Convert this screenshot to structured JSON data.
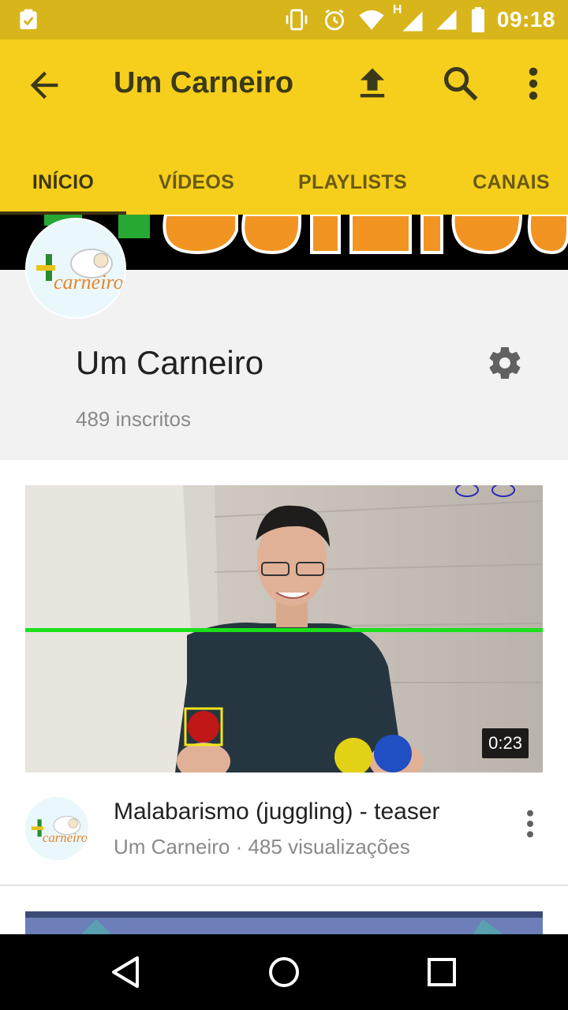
{
  "status_bar": {
    "time": "09:18",
    "network_label": "H",
    "icons": [
      "clipboard-check-icon",
      "vibrate-icon",
      "alarm-icon",
      "wifi-icon",
      "signal-icon",
      "signal-icon-2",
      "battery-icon"
    ]
  },
  "app_bar": {
    "title": "Um Carneiro",
    "icons": [
      "back-arrow-icon",
      "upload-icon",
      "search-icon",
      "more-vert-icon"
    ],
    "tabs": [
      {
        "label": "INÍCIO",
        "active": true
      },
      {
        "label": "VÍDEOS",
        "active": false
      },
      {
        "label": "PLAYLISTS",
        "active": false
      },
      {
        "label": "CANAIS",
        "active": false
      }
    ]
  },
  "channel": {
    "name": "Um Carneiro",
    "subscribers": "489 inscritos",
    "logo_text": "carneiro",
    "settings_icon": "gear-icon"
  },
  "video": {
    "title": "Malabarismo (juggling) - teaser",
    "meta": "Um Carneiro · 485 visualizações",
    "duration": "0:23"
  },
  "nav_bar": {
    "icons": [
      "back-triangle-icon",
      "home-circle-icon",
      "recents-square-icon"
    ]
  },
  "colors": {
    "app_bar": "#f5cf1c",
    "status_bar": "#d8b51a",
    "accent_text": "#3e3610"
  }
}
